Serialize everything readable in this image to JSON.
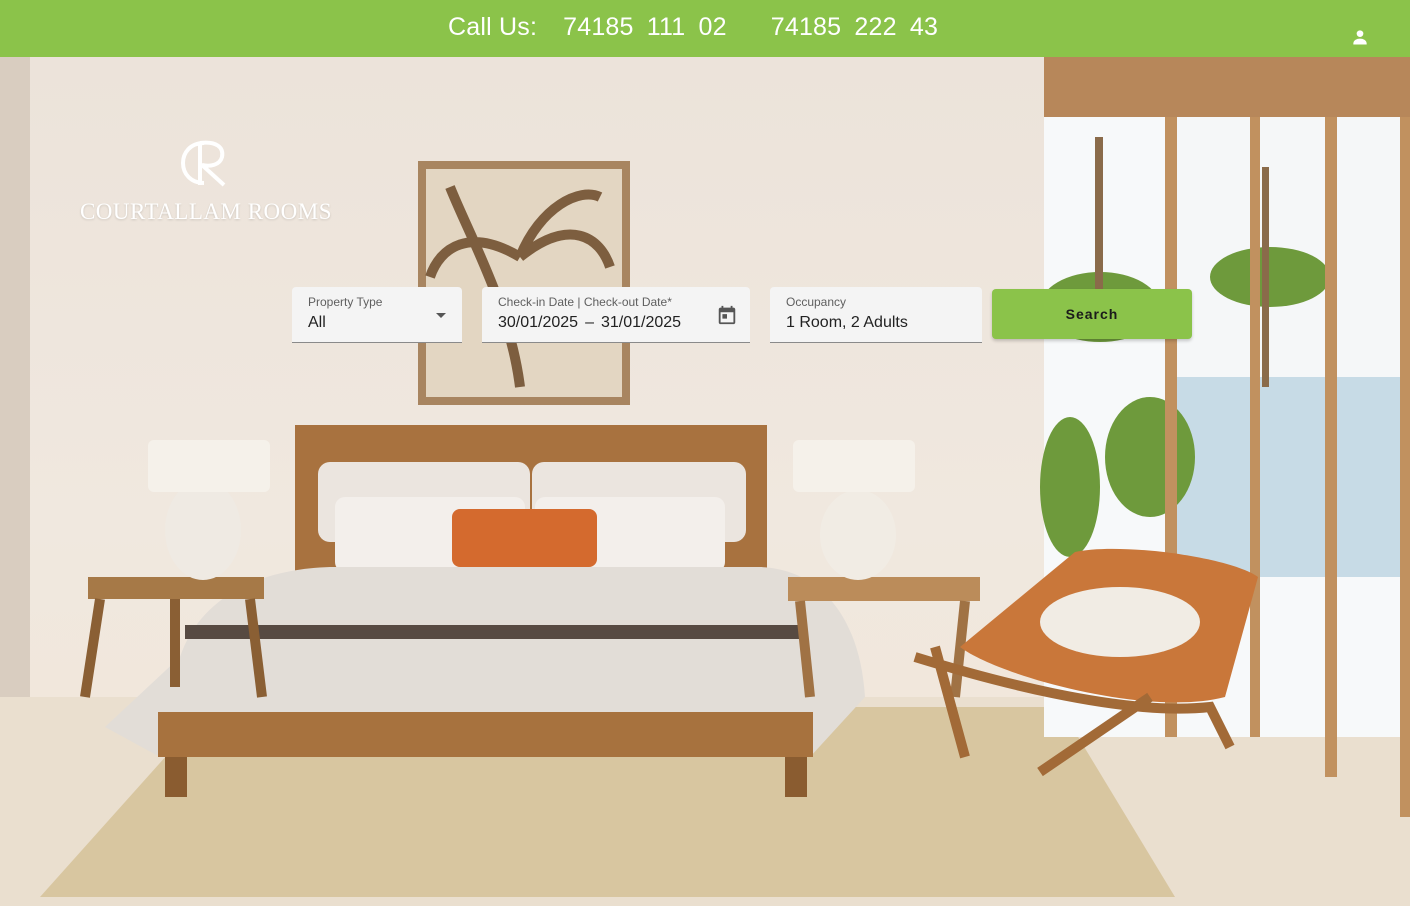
{
  "header": {
    "call_label": "Call Us:",
    "phone_1": "74185 111 02",
    "phone_2": "74185 222 43",
    "account_icon": "person-icon"
  },
  "brand": {
    "name": "COURTALLAM ROOMS",
    "monogram_icon": "cr-monogram-logo"
  },
  "search": {
    "property_type": {
      "label": "Property Type",
      "value": "All",
      "icon": "dropdown-arrow-icon"
    },
    "dates": {
      "label": "Check-in Date | Check-out Date*",
      "checkin": "30/01/2025",
      "separator": "–",
      "checkout": "31/01/2025",
      "icon": "calendar-icon"
    },
    "occupancy": {
      "label": "Occupancy",
      "value": "1 Room, 2 Adults"
    },
    "button_label": "Search"
  },
  "colors": {
    "brand_green": "#8bc34a",
    "text_white": "#ffffff"
  }
}
